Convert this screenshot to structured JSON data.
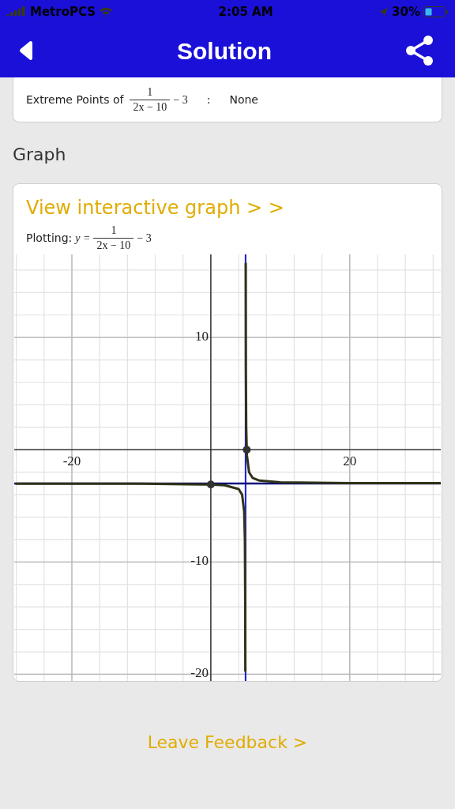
{
  "status_bar": {
    "carrier": "MetroPCS",
    "time": "2:05 AM",
    "battery": "30%"
  },
  "nav": {
    "title": "Solution"
  },
  "extreme_points": {
    "label": "Extreme Points of",
    "numerator": "1",
    "denominator": "2x − 10",
    "suffix": "− 3",
    "separator": ":",
    "value": "None"
  },
  "graph_section": {
    "heading": "Graph",
    "link": "View interactive graph > >",
    "plotting": {
      "label": "Plotting:",
      "lhs": "y =",
      "numerator": "1",
      "denominator": "2x − 10",
      "suffix": "− 3"
    },
    "chart_data": {
      "type": "line",
      "grid": true,
      "x": [
        -28,
        -20,
        -10,
        0,
        2,
        4,
        4.5,
        4.8,
        4.9,
        4.95,
        4.97,
        5,
        5.0255,
        5.05,
        5.1,
        5.17,
        5.2,
        5.5,
        6,
        7,
        10,
        20,
        33
      ],
      "series": [
        {
          "type": "line",
          "color": "#2f3318",
          "values": [
            -3.02,
            -3.02,
            -3.03,
            -3.1,
            -3.17,
            -3.5,
            -4,
            -5.5,
            -8,
            -13,
            -19.7,
            null,
            16.6,
            7,
            2,
            0,
            -0.5,
            -2,
            -2.5,
            -2.75,
            -2.9,
            -2.97,
            -2.98
          ]
        },
        {
          "type": "scatter",
          "color": "#333333",
          "values": [
            null,
            null,
            null,
            -3.1,
            null,
            null,
            null,
            null,
            null,
            null,
            null,
            null,
            null,
            null,
            null,
            0,
            null,
            null,
            null,
            null,
            null,
            null,
            null
          ]
        }
      ],
      "xlim": [
        -28.3,
        33.1
      ],
      "ylim": [
        -20.6,
        17.4
      ],
      "xticks": [
        -20,
        20
      ],
      "yticks": [
        10,
        -10,
        -20
      ],
      "ref_lines": [
        {
          "axis": "x",
          "value": 5,
          "color": "#1a1ad0"
        },
        {
          "axis": "y",
          "value": -3,
          "color": "#0a0a7a"
        }
      ]
    }
  },
  "feedback": {
    "link": "Leave Feedback >"
  }
}
